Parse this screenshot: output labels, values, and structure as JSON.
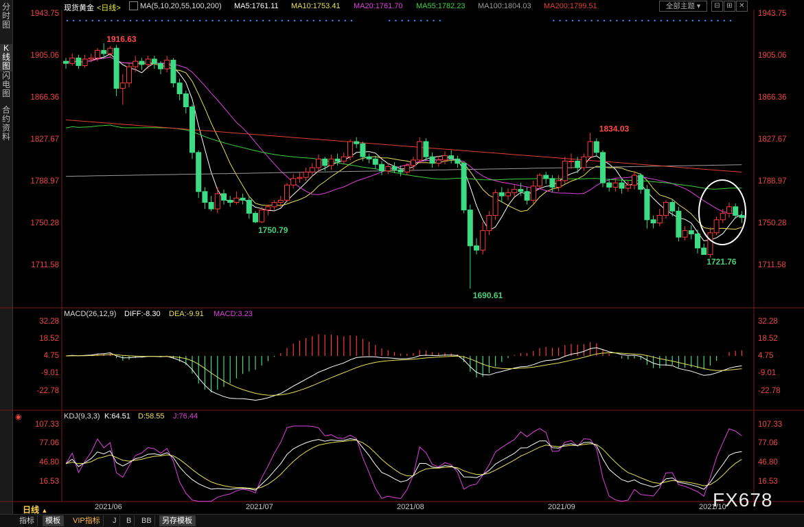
{
  "sidebar": {
    "tabs": [
      {
        "label": "分时图"
      },
      {
        "label": "K线图"
      },
      {
        "label": "闪电图"
      },
      {
        "label": "合约资料"
      }
    ]
  },
  "header": {
    "instrument": "现货黄金",
    "period": "<日线>",
    "ma_params": "MA(5,10,20,55,100,200)",
    "ma5": "MA5:1761.11",
    "ma10": "MA10:1753.41",
    "ma20": "MA20:1761.70",
    "ma55": "MA55:1782.23",
    "ma100": "MA100:1804.03",
    "ma200": "MA200:1799.51",
    "theme_label": "全部主题"
  },
  "colors": {
    "up": "#ff3a3a",
    "down": "#3ddc84",
    "ma5": "#ffffff",
    "ma10": "#e8e05a",
    "ma20": "#e040e0",
    "ma55": "#3cd23c",
    "ma100": "#9a9a9a",
    "ma200": "#e04030",
    "axis": "#e44"
  },
  "price_axis": [
    "1943.75",
    "1905.06",
    "1866.36",
    "1827.67",
    "1788.97",
    "1750.28",
    "1711.58"
  ],
  "annotations": {
    "high": "1916.63",
    "low1": "1750.79",
    "low2": "1690.61",
    "high2": "1834.03",
    "low3": "1721.76"
  },
  "macd": {
    "title": "MACD(26,12,9)",
    "diff": "DIFF:-8.30",
    "dea": "DEA:-9.91",
    "macd": "MACD:3.23",
    "axis": [
      "32.28",
      "18.52",
      "4.75",
      "-9.01",
      "-22.78"
    ]
  },
  "kdj": {
    "title": "KDJ(9,3,3)",
    "k": "K:64.51",
    "d": "D:58.55",
    "j": "J:76.44",
    "axis": [
      "107.33",
      "77.06",
      "46.80",
      "16.53"
    ]
  },
  "dates": [
    "2021/06",
    "2021/07",
    "2021/08",
    "2021/09",
    "2021/10"
  ],
  "footer": {
    "period": "日线",
    "tabs": [
      {
        "label": "指标"
      },
      {
        "label": "模板"
      },
      {
        "label": "VIP指标"
      },
      {
        "label": "J"
      },
      {
        "label": "B"
      },
      {
        "label": "BB"
      },
      {
        "label": "另存模板"
      }
    ]
  },
  "watermark": "FX678",
  "chart_data": {
    "type": "candlestick",
    "candles": [
      [
        1900,
        1898,
        1903,
        1893
      ],
      [
        1898,
        1903,
        1907,
        1896
      ],
      [
        1903,
        1896,
        1906,
        1893
      ],
      [
        1896,
        1902,
        1906,
        1894
      ],
      [
        1902,
        1903,
        1907,
        1899
      ],
      [
        1903,
        1910,
        1912,
        1900
      ],
      [
        1910,
        1907,
        1916.63,
        1903
      ],
      [
        1907,
        1912,
        1914,
        1904
      ],
      [
        1912,
        1875,
        1915,
        1868
      ],
      [
        1875,
        1880,
        1888,
        1860
      ],
      [
        1880,
        1895,
        1898,
        1876
      ],
      [
        1895,
        1900,
        1905,
        1890
      ],
      [
        1900,
        1897,
        1903,
        1892
      ],
      [
        1897,
        1902,
        1905,
        1893
      ],
      [
        1902,
        1898,
        1905,
        1893
      ],
      [
        1898,
        1893,
        1900,
        1888
      ],
      [
        1893,
        1901,
        1905,
        1890
      ],
      [
        1901,
        1880,
        1903,
        1876
      ],
      [
        1880,
        1870,
        1884,
        1864
      ],
      [
        1870,
        1858,
        1873,
        1852
      ],
      [
        1858,
        1816,
        1860,
        1810
      ],
      [
        1816,
        1780,
        1818,
        1774
      ],
      [
        1780,
        1770,
        1784,
        1764
      ],
      [
        1770,
        1764,
        1776,
        1762
      ],
      [
        1764,
        1778,
        1784,
        1760
      ],
      [
        1778,
        1772,
        1782,
        1768
      ],
      [
        1772,
        1770,
        1776,
        1766
      ],
      [
        1770,
        1774,
        1780,
        1768
      ],
      [
        1774,
        1772,
        1778,
        1768
      ],
      [
        1772,
        1760,
        1775,
        1755
      ],
      [
        1760,
        1752,
        1762,
        1750.79
      ],
      [
        1752,
        1763,
        1766,
        1751
      ],
      [
        1763,
        1766,
        1768,
        1758
      ],
      [
        1766,
        1770,
        1772,
        1763
      ],
      [
        1770,
        1772,
        1776,
        1766
      ],
      [
        1772,
        1786,
        1788,
        1770
      ],
      [
        1786,
        1792,
        1796,
        1783
      ],
      [
        1792,
        1793,
        1798,
        1788
      ],
      [
        1793,
        1798,
        1802,
        1790
      ],
      [
        1798,
        1802,
        1806,
        1794
      ],
      [
        1802,
        1810,
        1814,
        1798
      ],
      [
        1810,
        1804,
        1812,
        1799
      ],
      [
        1804,
        1810,
        1814,
        1800
      ],
      [
        1810,
        1808,
        1815,
        1804
      ],
      [
        1808,
        1812,
        1816,
        1805
      ],
      [
        1812,
        1826,
        1828,
        1809
      ],
      [
        1826,
        1824,
        1830,
        1820
      ],
      [
        1824,
        1812,
        1826,
        1808
      ],
      [
        1812,
        1810,
        1815,
        1806
      ],
      [
        1810,
        1805,
        1813,
        1801
      ],
      [
        1805,
        1799,
        1808,
        1795
      ],
      [
        1799,
        1803,
        1806,
        1796
      ],
      [
        1803,
        1800,
        1807,
        1797
      ],
      [
        1800,
        1798,
        1804,
        1794
      ],
      [
        1798,
        1804,
        1806,
        1795
      ],
      [
        1804,
        1809,
        1812,
        1800
      ],
      [
        1809,
        1826,
        1830,
        1806
      ],
      [
        1826,
        1812,
        1829,
        1808
      ],
      [
        1812,
        1806,
        1816,
        1802
      ],
      [
        1806,
        1809,
        1813,
        1803
      ],
      [
        1809,
        1813,
        1817,
        1805
      ],
      [
        1813,
        1810,
        1818,
        1806
      ],
      [
        1810,
        1806,
        1813,
        1802
      ],
      [
        1806,
        1763,
        1808,
        1760
      ],
      [
        1763,
        1730,
        1768,
        1690.61
      ],
      [
        1730,
        1726,
        1737,
        1722
      ],
      [
        1726,
        1744,
        1752,
        1722
      ],
      [
        1744,
        1758,
        1762,
        1740
      ],
      [
        1758,
        1779,
        1782,
        1754
      ],
      [
        1779,
        1776,
        1784,
        1770
      ],
      [
        1776,
        1779,
        1783,
        1772
      ],
      [
        1779,
        1782,
        1786,
        1775
      ],
      [
        1782,
        1780,
        1788,
        1776
      ],
      [
        1780,
        1772,
        1784,
        1768
      ],
      [
        1772,
        1785,
        1790,
        1769
      ],
      [
        1785,
        1795,
        1797,
        1782
      ],
      [
        1795,
        1792,
        1798,
        1787
      ],
      [
        1792,
        1784,
        1795,
        1779
      ],
      [
        1784,
        1790,
        1795,
        1780
      ],
      [
        1790,
        1808,
        1812,
        1787
      ],
      [
        1808,
        1808,
        1815,
        1801
      ],
      [
        1808,
        1802,
        1812,
        1797
      ],
      [
        1802,
        1812,
        1815,
        1799
      ],
      [
        1812,
        1826,
        1834.03,
        1810
      ],
      [
        1826,
        1816,
        1829,
        1812
      ],
      [
        1816,
        1788,
        1818,
        1784
      ],
      [
        1788,
        1784,
        1792,
        1780
      ],
      [
        1784,
        1788,
        1792,
        1780
      ],
      [
        1788,
        1783,
        1792,
        1778
      ],
      [
        1783,
        1786,
        1790,
        1780
      ],
      [
        1786,
        1795,
        1799,
        1782
      ],
      [
        1795,
        1782,
        1797,
        1778
      ],
      [
        1782,
        1754,
        1786,
        1746
      ],
      [
        1754,
        1751,
        1758,
        1746
      ],
      [
        1751,
        1758,
        1764,
        1748
      ],
      [
        1758,
        1770,
        1772,
        1755
      ],
      [
        1770,
        1762,
        1773,
        1757
      ],
      [
        1762,
        1738,
        1766,
        1734
      ],
      [
        1738,
        1744,
        1748,
        1735
      ],
      [
        1744,
        1741,
        1749,
        1736
      ],
      [
        1741,
        1728,
        1745,
        1723
      ],
      [
        1728,
        1722,
        1732,
        1721.76
      ],
      [
        1722,
        1742,
        1747,
        1719
      ],
      [
        1742,
        1754,
        1757,
        1740
      ],
      [
        1754,
        1760,
        1764,
        1751
      ],
      [
        1760,
        1766,
        1770,
        1756
      ],
      [
        1766,
        1758,
        1769,
        1755
      ],
      [
        1758,
        1756,
        1762,
        1751
      ]
    ],
    "ylim": [
      1672.9,
      1943.75
    ]
  }
}
